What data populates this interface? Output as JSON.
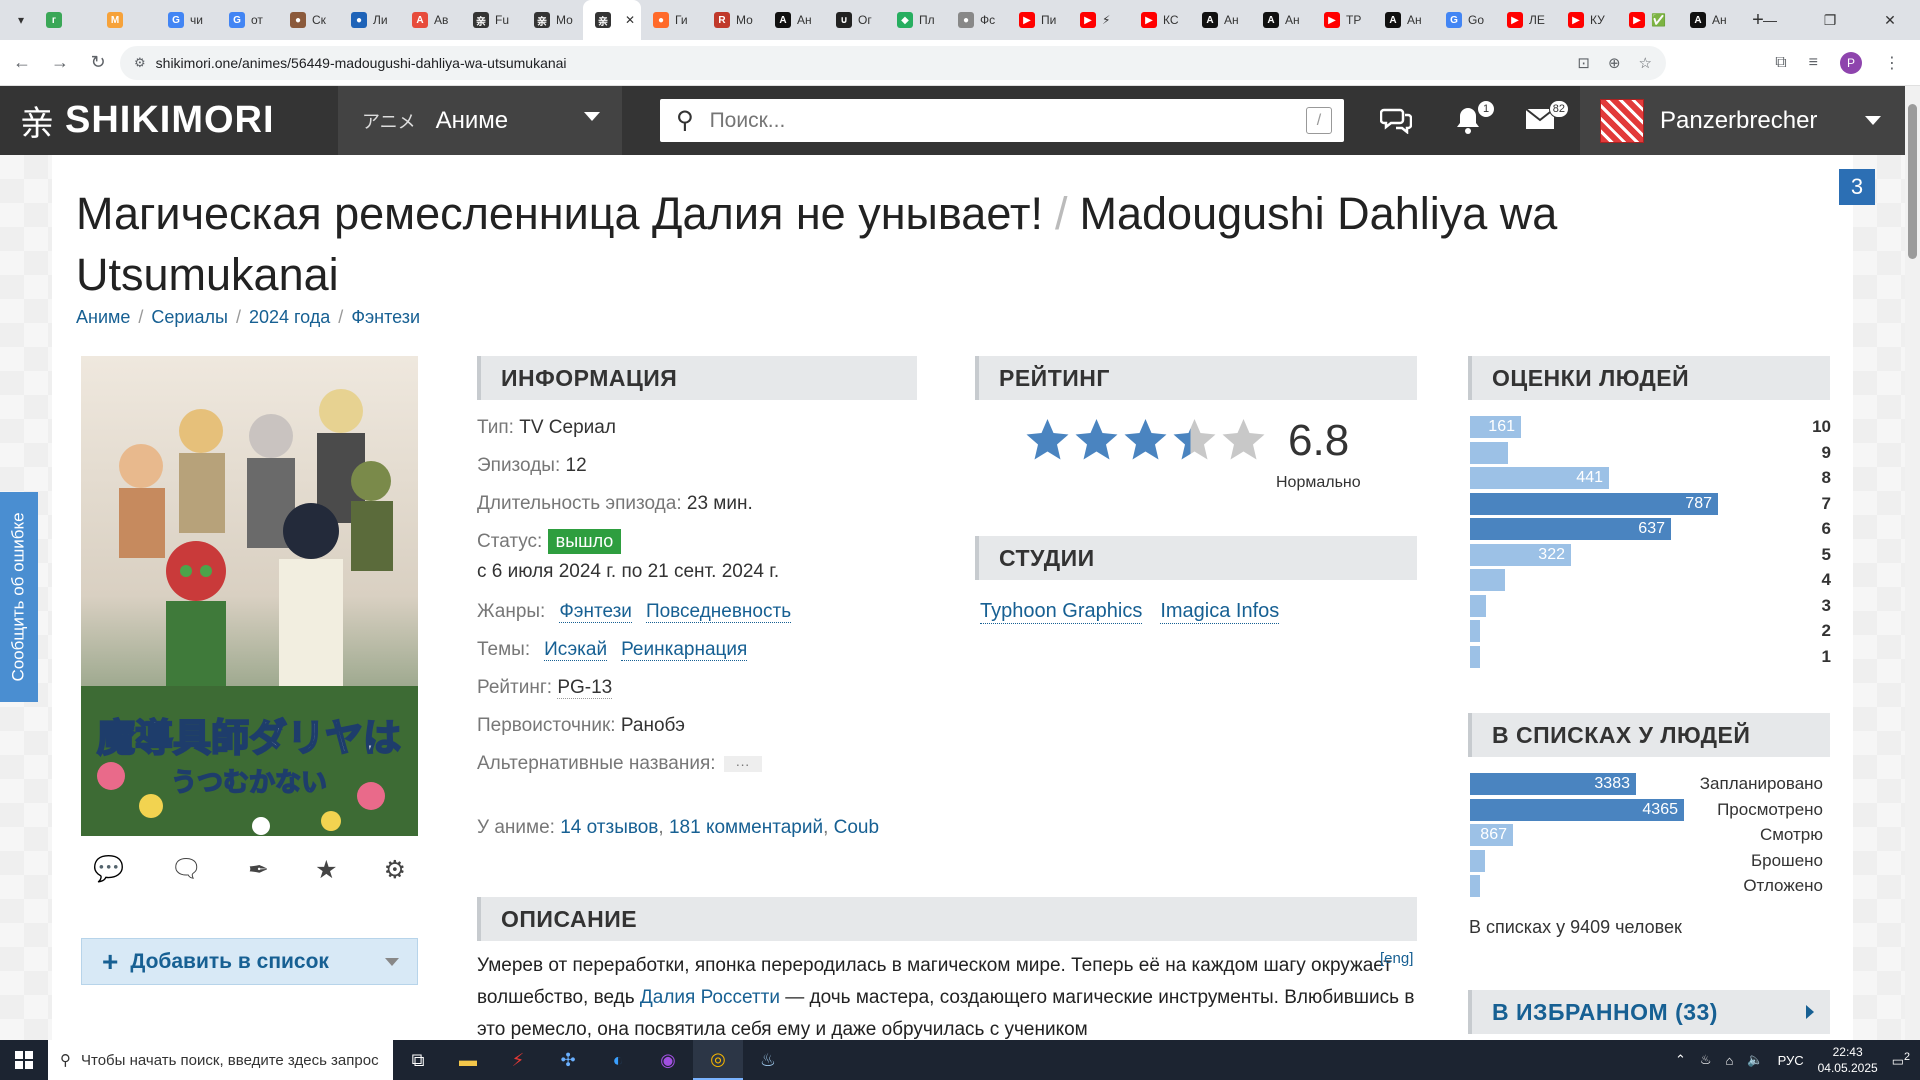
{
  "browser": {
    "tabs": [
      {
        "fav": "г",
        "color": "#3aa757",
        "label": ""
      },
      {
        "fav": "М",
        "color": "#f6a23a",
        "label": ""
      },
      {
        "fav": "G",
        "color": "#4285f4",
        "label": "чи"
      },
      {
        "fav": "G",
        "color": "#4285f4",
        "label": "от"
      },
      {
        "fav": "●",
        "color": "#8b5a3c",
        "label": "Ск"
      },
      {
        "fav": "●",
        "color": "#1e63b8",
        "label": "Ли"
      },
      {
        "fav": "A",
        "color": "#e74c3c",
        "label": "Ав"
      },
      {
        "fav": "亲",
        "color": "#343434",
        "label": "Fu"
      },
      {
        "fav": "亲",
        "color": "#343434",
        "label": "Мо"
      },
      {
        "fav": "亲",
        "color": "#343434",
        "label": "",
        "active": true
      },
      {
        "fav": "●",
        "color": "#ff6a2a",
        "label": "Ги"
      },
      {
        "fav": "R",
        "color": "#c0392b",
        "label": "Мо"
      },
      {
        "fav": "A",
        "color": "#111111",
        "label": "Ан"
      },
      {
        "fav": "∪",
        "color": "#222222",
        "label": "Ог"
      },
      {
        "fav": "◆",
        "color": "#27ae60",
        "label": "Пл"
      },
      {
        "fav": "●",
        "color": "#888888",
        "label": "Фс"
      },
      {
        "fav": "▶",
        "color": "#ff0000",
        "label": "Пи"
      },
      {
        "fav": "▶",
        "color": "#ff0000",
        "label": "⚡"
      },
      {
        "fav": "▶",
        "color": "#ff0000",
        "label": "КС"
      },
      {
        "fav": "A",
        "color": "#111111",
        "label": "Ан"
      },
      {
        "fav": "A",
        "color": "#111111",
        "label": "Ан"
      },
      {
        "fav": "▶",
        "color": "#ff0000",
        "label": "ТР"
      },
      {
        "fav": "A",
        "color": "#111111",
        "label": "Ан"
      },
      {
        "fav": "G",
        "color": "#4285f4",
        "label": "Go"
      },
      {
        "fav": "▶",
        "color": "#ff0000",
        "label": "ЛЕ"
      },
      {
        "fav": "▶",
        "color": "#ff0000",
        "label": "КУ"
      },
      {
        "fav": "▶",
        "color": "#ff0000",
        "label": "✅"
      },
      {
        "fav": "A",
        "color": "#111111",
        "label": "Ан"
      }
    ],
    "url": "shikimori.one/animes/56449-madougushi-dahliya-wa-utsumukanai"
  },
  "header": {
    "logo": "SHIKIMORI",
    "section_jp": "アニメ",
    "section": "Аниме",
    "search_placeholder": "Поиск...",
    "search_hotkey": "/",
    "notifications_count": "1",
    "messages_count": "82",
    "username": "Panzerbrecher"
  },
  "page": {
    "report_label": "Сообщить об ошибке",
    "counter": "3",
    "title_ru": "Магическая ремесленница Далия не унывает!",
    "title_sep": "/",
    "title_en": "Madougushi Dahliya wa Utsumukanai",
    "breadcrumbs": [
      "Аниме",
      "Сериалы",
      "2024 года",
      "Фэнтези"
    ],
    "poster_text": "魔導具師ダリヤは うつむかない",
    "add_to_list": "Добавить в список"
  },
  "info": {
    "heading": "ИНФОРМАЦИЯ",
    "type_k": "Тип:",
    "type_v": "TV Сериал",
    "episodes_k": "Эпизоды:",
    "episodes_v": "12",
    "duration_k": "Длительность эпизода:",
    "duration_v": "23 мин.",
    "status_k": "Статус:",
    "status_v": "вышло",
    "dates": "с 6 июля 2024 г. по 21 сент. 2024 г.",
    "genres_k": "Жанры:",
    "genres": [
      "Фэнтези",
      "Повседневность"
    ],
    "themes_k": "Темы:",
    "themes": [
      "Исэкай",
      "Реинкарнация"
    ],
    "rating_k": "Рейтинг:",
    "rating_v": "PG-13",
    "source_k": "Первоисточник:",
    "source_v": "Ранобэ",
    "alt_k": "Альтернативные названия:",
    "alt_v": "···",
    "links_k": "У аниме:",
    "links": [
      "14 отзывов",
      "181 комментарий",
      "Coub"
    ]
  },
  "rating": {
    "heading": "РЕЙТИНГ",
    "score": "6.8",
    "stars_filled": 3.4,
    "label": "Нормально"
  },
  "studios": {
    "heading": "СТУДИИ",
    "items": [
      "Typhoon Graphics",
      "Imagica Infos"
    ]
  },
  "scores": {
    "heading": "ОЦЕНКИ ЛЮДЕЙ",
    "rows": [
      {
        "score": "10",
        "count": 161,
        "label": "161",
        "dark": false
      },
      {
        "score": "9",
        "count": 120,
        "label": "",
        "dark": false
      },
      {
        "score": "8",
        "count": 441,
        "label": "441",
        "dark": false
      },
      {
        "score": "7",
        "count": 787,
        "label": "787",
        "dark": true
      },
      {
        "score": "6",
        "count": 637,
        "label": "637",
        "dark": true
      },
      {
        "score": "5",
        "count": 322,
        "label": "322",
        "dark": false
      },
      {
        "score": "4",
        "count": 110,
        "label": "",
        "dark": false
      },
      {
        "score": "3",
        "count": 50,
        "label": "",
        "dark": false
      },
      {
        "score": "2",
        "count": 22,
        "label": "",
        "dark": false
      },
      {
        "score": "1",
        "count": 22,
        "label": "",
        "dark": false
      }
    ]
  },
  "lists": {
    "heading": "В СПИСКАХ У ЛЮДЕЙ",
    "rows": [
      {
        "name": "Запланировано",
        "count": 3383,
        "label": "3383",
        "dark": true
      },
      {
        "name": "Просмотрено",
        "count": 4365,
        "label": "4365",
        "dark": true
      },
      {
        "name": "Смотрю",
        "count": 867,
        "label": "867",
        "dark": false
      },
      {
        "name": "Брошено",
        "count": 310,
        "label": "",
        "dark": false
      },
      {
        "name": "Отложено",
        "count": 100,
        "label": "",
        "dark": false
      }
    ],
    "summary": "В списках у 9409 человек"
  },
  "favourites": {
    "heading": "В ИЗБРАННОМ",
    "count": "(33)"
  },
  "description": {
    "heading": "ОПИСАНИЕ",
    "eng_link": "[eng]",
    "text_1": "Умерев от переработки, японка переродилась в магическом мире. Теперь её на каждом шагу окружает волшебство, ведь ",
    "link": "Далия Россетти",
    "text_2": " — дочь мастера, создающего магические инструменты. Влюбившись в это ремесло, она посвятила себя ему и даже обручилась с учеником"
  },
  "taskbar": {
    "search_placeholder": "Чтобы начать поиск, введите здесь запрос",
    "lang": "РУС",
    "time": "22:43",
    "date": "04.05.2025",
    "notif": "2"
  },
  "colors": {
    "header_bg": "#343434",
    "link": "#176093",
    "bar_dark": "#4a84c0",
    "bar_light": "#9cc1e6",
    "status_green": "#2e9e3f",
    "star": "#4a84c0"
  }
}
